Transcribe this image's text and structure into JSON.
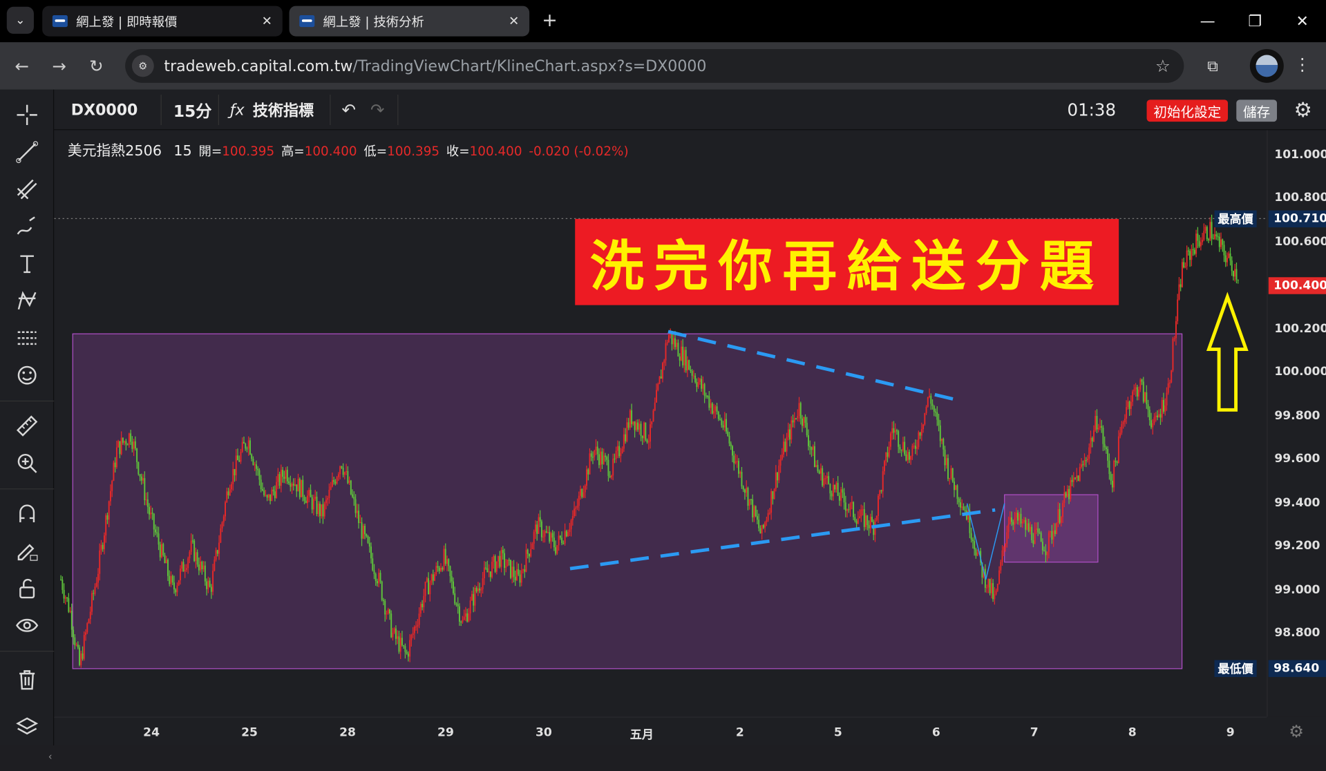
{
  "browser": {
    "tabs": [
      {
        "title": "網上發 | 即時報價",
        "active": false
      },
      {
        "title": "網上發 | 技術分析",
        "active": true
      }
    ],
    "url_host": "tradeweb.capital.com.tw",
    "url_path": "/TradingViewChart/KlineChart.aspx?s=DX0000"
  },
  "toolbar": {
    "symbol": "DX0000",
    "interval": "15分",
    "indicators_label": "技術指標",
    "clock": "01:38",
    "reset_label": "初始化設定",
    "save_label": "儲存"
  },
  "legend": {
    "name": "美元指熱2506",
    "interval": "15",
    "open_label": "開=",
    "open": "100.395",
    "high_label": "高=",
    "high": "100.400",
    "low_label": "低=",
    "low": "100.395",
    "close_label": "收=",
    "close": "100.400",
    "change": "-0.020 (-0.02%)"
  },
  "banner_text": "洗完你再給送分題",
  "price_tags": {
    "high_label": "最高價",
    "high_value": "100.710",
    "last_value": "100.400",
    "low_label": "最低價",
    "low_value": "98.640"
  },
  "colors": {
    "up": "#e52929",
    "down": "#5ec43b",
    "range_box": "#b04fc7",
    "trendline": "#2b9af3",
    "arrow": "#fff200",
    "banner_bg": "#ed1b23"
  },
  "chart_data": {
    "type": "candlestick",
    "symbol": "美元指熱2506",
    "interval": "15",
    "y_ticks": [
      101.0,
      100.8,
      100.6,
      100.4,
      100.2,
      100.0,
      99.8,
      99.6,
      99.4,
      99.2,
      99.0,
      98.8
    ],
    "y_tick_labels": [
      "101.000",
      "100.800",
      "100.600",
      "100.400",
      "100.200",
      "100.000",
      "99.800",
      "99.600",
      "99.400",
      "99.200",
      "99.000",
      "98.800"
    ],
    "ylim": [
      98.5,
      101.05
    ],
    "x_ticks": [
      "24",
      "25",
      "28",
      "29",
      "30",
      "五月",
      "2",
      "5",
      "6",
      "7",
      "8",
      "9"
    ],
    "highest": 100.71,
    "lowest": 98.64,
    "last": 100.4,
    "path_points": [
      [
        0,
        99.05
      ],
      [
        2,
        98.9
      ],
      [
        4,
        98.65
      ],
      [
        8,
        99.1
      ],
      [
        12,
        99.65
      ],
      [
        15,
        99.72
      ],
      [
        19,
        99.35
      ],
      [
        24,
        99.0
      ],
      [
        28,
        99.2
      ],
      [
        32,
        99.0
      ],
      [
        36,
        99.5
      ],
      [
        40,
        99.7
      ],
      [
        44,
        99.4
      ],
      [
        48,
        99.55
      ],
      [
        52,
        99.45
      ],
      [
        56,
        99.35
      ],
      [
        60,
        99.6
      ],
      [
        64,
        99.3
      ],
      [
        68,
        99.05
      ],
      [
        71,
        98.8
      ],
      [
        74,
        98.7
      ],
      [
        78,
        99.0
      ],
      [
        82,
        99.15
      ],
      [
        86,
        98.85
      ],
      [
        90,
        99.05
      ],
      [
        94,
        99.15
      ],
      [
        98,
        99.05
      ],
      [
        102,
        99.3
      ],
      [
        106,
        99.2
      ],
      [
        110,
        99.35
      ],
      [
        114,
        99.65
      ],
      [
        118,
        99.55
      ],
      [
        122,
        99.8
      ],
      [
        126,
        99.7
      ],
      [
        130,
        100.18
      ],
      [
        134,
        100.05
      ],
      [
        138,
        99.9
      ],
      [
        142,
        99.75
      ],
      [
        146,
        99.5
      ],
      [
        150,
        99.25
      ],
      [
        154,
        99.6
      ],
      [
        158,
        99.85
      ],
      [
        162,
        99.55
      ],
      [
        166,
        99.45
      ],
      [
        170,
        99.35
      ],
      [
        174,
        99.3
      ],
      [
        178,
        99.75
      ],
      [
        182,
        99.6
      ],
      [
        186,
        99.9
      ],
      [
        190,
        99.55
      ],
      [
        194,
        99.35
      ],
      [
        197,
        99.1
      ],
      [
        200,
        98.95
      ],
      [
        203,
        99.35
      ],
      [
        207,
        99.28
      ],
      [
        211,
        99.2
      ],
      [
        215,
        99.42
      ],
      [
        219,
        99.58
      ],
      [
        222,
        99.8
      ],
      [
        225,
        99.5
      ],
      [
        228,
        99.85
      ],
      [
        231,
        99.95
      ],
      [
        234,
        99.75
      ],
      [
        237,
        99.92
      ],
      [
        240,
        100.48
      ],
      [
        243,
        100.6
      ],
      [
        246,
        100.66
      ],
      [
        249,
        100.55
      ],
      [
        252,
        100.45
      ]
    ],
    "rect_range": {
      "from_index": 0,
      "to_index": 240,
      "low": 98.64,
      "high": 100.18
    },
    "small_box": {
      "from_index": 202,
      "to_index": 222,
      "low": 99.13,
      "high": 99.44
    },
    "trendlines": [
      {
        "style": "dashed",
        "from": [
          130,
          100.19
        ],
        "to": [
          193,
          99.87
        ]
      },
      {
        "style": "dashed",
        "from": [
          109,
          99.1
        ],
        "to": [
          200,
          99.37
        ]
      }
    ],
    "arrow": {
      "direction": "up",
      "index": 249,
      "from_price": 99.83,
      "to_price": 100.35
    }
  }
}
